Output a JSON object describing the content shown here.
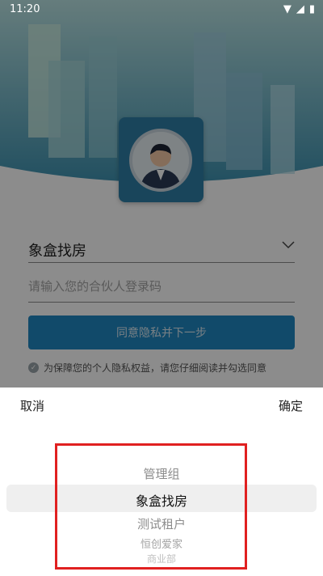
{
  "status_bar": {
    "time": "11:20"
  },
  "login": {
    "org_selected": "象盒找房",
    "code_placeholder": "请输入您的合伙人登录码",
    "submit_label": "同意隐私并下一步",
    "privacy_notice": "为保障您的个人隐私权益，请您仔细阅读并勾选同意"
  },
  "picker": {
    "cancel_label": "取消",
    "confirm_label": "确定",
    "options": [
      "管理组",
      "象盒找房",
      "测试租户",
      "恒创爱家",
      "商业部"
    ],
    "selected_index": 1
  },
  "colors": {
    "accent": "#1f88c2",
    "highlight": "#e02020"
  }
}
